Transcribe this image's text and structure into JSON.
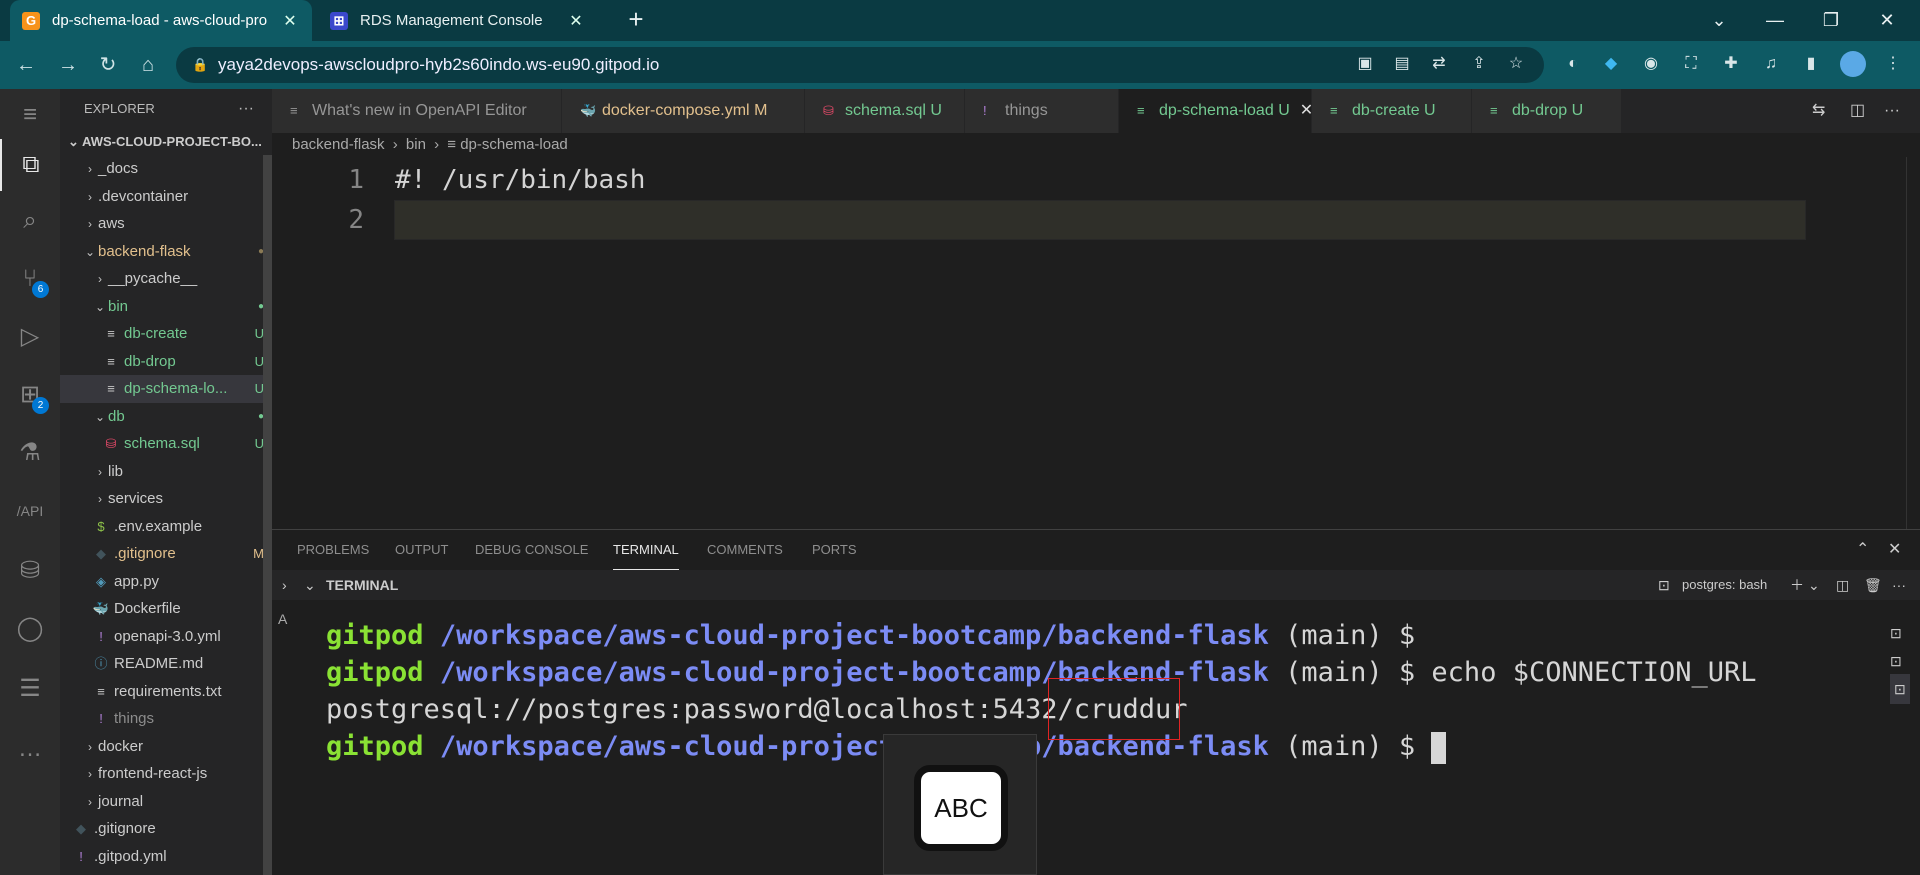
{
  "colors": {
    "browser_frame": "#0a3a42",
    "browser_toolbar": "#0e5a64",
    "git_untracked": "#73c991",
    "git_modified": "#e2c08d",
    "prompt_green": "#8ae234",
    "prompt_blue": "#7c8cf5",
    "highlight_box": "#e02424"
  },
  "browser": {
    "tabs": [
      {
        "title": "dp-schema-load - aws-cloud-pro",
        "icon": "gitpod-icon",
        "active": true
      },
      {
        "title": "RDS Management Console",
        "icon": "aws-rds-icon",
        "active": false
      }
    ],
    "url": "yaya2devops-awscloudpro-hyb2s60indo.ws-eu90.gitpod.io"
  },
  "explorer": {
    "title": "EXPLORER",
    "root": "AWS-CLOUD-PROJECT-BO...",
    "items": [
      {
        "label": "_docs",
        "type": "folder",
        "status": ""
      },
      {
        "label": ".devcontainer",
        "type": "folder",
        "status": ""
      },
      {
        "label": "aws",
        "type": "folder",
        "status": ""
      },
      {
        "label": "backend-flask",
        "type": "folder-open",
        "status": "●"
      },
      {
        "label": "__pycache__",
        "type": "folder",
        "status": ""
      },
      {
        "label": "bin",
        "type": "folder-open",
        "status": "●"
      },
      {
        "label": "db-create",
        "type": "file",
        "status": "U"
      },
      {
        "label": "db-drop",
        "type": "file",
        "status": "U"
      },
      {
        "label": "dp-schema-lo...",
        "type": "file",
        "status": "U"
      },
      {
        "label": "db",
        "type": "folder-open",
        "status": "●"
      },
      {
        "label": "schema.sql",
        "type": "sql",
        "status": "U"
      },
      {
        "label": "lib",
        "type": "folder",
        "status": ""
      },
      {
        "label": "services",
        "type": "folder",
        "status": ""
      },
      {
        "label": ".env.example",
        "type": "env",
        "status": ""
      },
      {
        "label": ".gitignore",
        "type": "git",
        "status": "M"
      },
      {
        "label": "app.py",
        "type": "py",
        "status": ""
      },
      {
        "label": "Dockerfile",
        "type": "docker",
        "status": ""
      },
      {
        "label": "openapi-3.0.yml",
        "type": "yml",
        "status": ""
      },
      {
        "label": "README.md",
        "type": "info",
        "status": ""
      },
      {
        "label": "requirements.txt",
        "type": "file",
        "status": ""
      },
      {
        "label": "things",
        "type": "yml",
        "status": ""
      },
      {
        "label": "docker",
        "type": "folder",
        "status": ""
      },
      {
        "label": "frontend-react-js",
        "type": "folder",
        "status": ""
      },
      {
        "label": "journal",
        "type": "folder",
        "status": ""
      },
      {
        "label": ".gitignore",
        "type": "git",
        "status": ""
      },
      {
        "label": ".gitpod.yml",
        "type": "yml",
        "status": ""
      }
    ]
  },
  "activity": {
    "source_control_badge": "6",
    "extensions_badge": "2"
  },
  "editor": {
    "tabs": [
      {
        "label": "What's new in OpenAPI Editor",
        "status": ""
      },
      {
        "label": "docker-compose.yml",
        "status": "M"
      },
      {
        "label": "schema.sql",
        "status": "U"
      },
      {
        "label": "things",
        "status": ""
      },
      {
        "label": "dp-schema-load",
        "status": "U"
      },
      {
        "label": "db-create",
        "status": "U"
      },
      {
        "label": "db-drop",
        "status": "U"
      }
    ],
    "breadcrumb": [
      "backend-flask",
      "bin",
      "dp-schema-load"
    ],
    "lines": [
      {
        "num": "1",
        "text": "#! /usr/bin/bash"
      },
      {
        "num": "2",
        "text": ""
      }
    ]
  },
  "panel": {
    "tabs": [
      "PROBLEMS",
      "OUTPUT",
      "DEBUG CONSOLE",
      "TERMINAL",
      "COMMENTS",
      "PORTS"
    ],
    "terminal_label": "TERMINAL",
    "shell_label": "postgres: bash",
    "terminal": {
      "user": "gitpod",
      "path": "/workspace/aws-cloud-project-bootcamp/backend-flask",
      "branch": "(main) $",
      "command": "echo $CONNECTION_URL",
      "output": "postgresql://postgres:password@localhost:5432/cruddur"
    }
  },
  "keyboard_overlay": {
    "label": "ABC"
  }
}
